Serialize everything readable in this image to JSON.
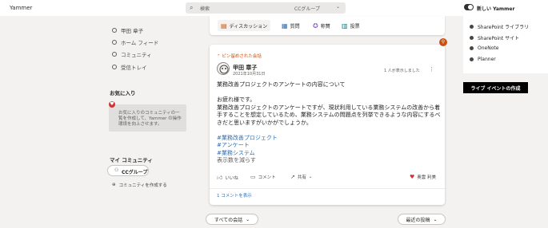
{
  "app": {
    "name": "Yammer"
  },
  "search": {
    "placeholder": "検索",
    "scope": "CCグループ"
  },
  "header": {
    "new_yammer_label": "新しい Yammer"
  },
  "left_nav": {
    "items": [
      {
        "label": "甲田 章子",
        "icon": "user-icon"
      },
      {
        "label": "ホーム フィード",
        "icon": "home-icon"
      },
      {
        "label": "コミュニティ",
        "icon": "community-icon"
      },
      {
        "label": "受信トレイ",
        "icon": "inbox-icon"
      }
    ],
    "favorites_heading": "お気に入り",
    "favorites_hint": "お気に入りのコミュニティの一覧を作成して、Yammer の操作環境を向上させます。",
    "my_communities_heading": "マイ コミュニティ",
    "group_pill": "CCグループ",
    "create_community": "コミュニティを作成する"
  },
  "publisher": {
    "tabs": [
      {
        "label": "ディスカッション",
        "icon": "discussion-icon",
        "color": "#ca5010"
      },
      {
        "label": "質問",
        "icon": "question-icon",
        "color": "#2e6fb3"
      },
      {
        "label": "称賛",
        "icon": "praise-icon",
        "color": "#8764b8"
      },
      {
        "label": "投票",
        "icon": "poll-icon",
        "color": "#038387"
      }
    ]
  },
  "post": {
    "pinned_label": "ピン留めされた会話",
    "author": "甲田 章子",
    "date": "2021年10月31日",
    "seen_by": "1 人が表示しました",
    "title_line": "業務改善プロジェクトのアンケートの内容について",
    "body_lines": [
      "お疲れ様です。",
      "業務改善プロジェクトのアンケートですが、現状利用している業務システムの改善から着手することを想定しているため、業務システムの問題点を列挙できるような内容にするべきだと思いますがいかがでしょうか。"
    ],
    "tags": [
      "#業務改善プロジェクト",
      "#アンケート",
      "#業務システム"
    ],
    "translate": "表示数を減らす",
    "actions": {
      "like": "いいね",
      "comment": "コメント",
      "share": "共有"
    },
    "liked_by": "奥雲 利美",
    "show_comments": "1 コメントを表示"
  },
  "feed_footer": {
    "all_conversations": "すべての会話",
    "recent_posts": "最近の投稿"
  },
  "right_panel": {
    "items": [
      {
        "label": "SharePoint ライブラリ"
      },
      {
        "label": "SharePoint サイト"
      },
      {
        "label": "OneNote"
      },
      {
        "label": "Planner"
      }
    ],
    "live_event_button": "ライブ イベントの作成"
  },
  "colors": {
    "accent_orange": "#ca5010",
    "link_blue": "#2e6fb3",
    "heart_red": "#d13438"
  }
}
